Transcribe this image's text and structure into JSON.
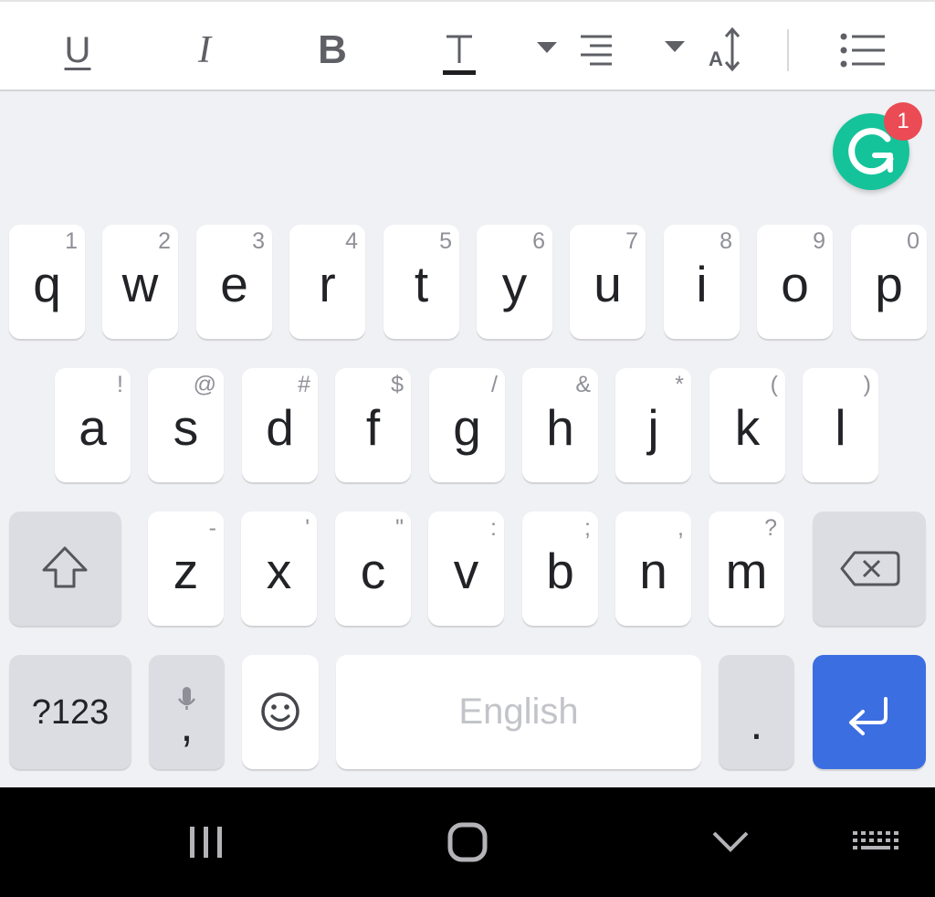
{
  "toolbar": {
    "underline_label": "U",
    "italic_label": "I",
    "bold_label": "B",
    "font_size_label": "A"
  },
  "grammarly": {
    "badge_count": "1"
  },
  "keyboard": {
    "row1": [
      {
        "char": "q",
        "hint": "1"
      },
      {
        "char": "w",
        "hint": "2"
      },
      {
        "char": "e",
        "hint": "3"
      },
      {
        "char": "r",
        "hint": "4"
      },
      {
        "char": "t",
        "hint": "5"
      },
      {
        "char": "y",
        "hint": "6"
      },
      {
        "char": "u",
        "hint": "7"
      },
      {
        "char": "i",
        "hint": "8"
      },
      {
        "char": "o",
        "hint": "9"
      },
      {
        "char": "p",
        "hint": "0"
      }
    ],
    "row2": [
      {
        "char": "a",
        "hint": "!"
      },
      {
        "char": "s",
        "hint": "@"
      },
      {
        "char": "d",
        "hint": "#"
      },
      {
        "char": "f",
        "hint": "$"
      },
      {
        "char": "g",
        "hint": "/"
      },
      {
        "char": "h",
        "hint": "&"
      },
      {
        "char": "j",
        "hint": "*"
      },
      {
        "char": "k",
        "hint": "("
      },
      {
        "char": "l",
        "hint": ")"
      }
    ],
    "row3": [
      {
        "char": "z",
        "hint": "-"
      },
      {
        "char": "x",
        "hint": "'"
      },
      {
        "char": "c",
        "hint": "\""
      },
      {
        "char": "v",
        "hint": ":"
      },
      {
        "char": "b",
        "hint": ";"
      },
      {
        "char": "n",
        "hint": ","
      },
      {
        "char": "m",
        "hint": "?"
      }
    ],
    "symbols_label": "?123",
    "comma_label": ",",
    "space_label": "English",
    "period_label": "."
  },
  "colors": {
    "enter_key": "#3b6ee0",
    "grammarly": "#15c39a",
    "badge": "#ea4b55"
  }
}
